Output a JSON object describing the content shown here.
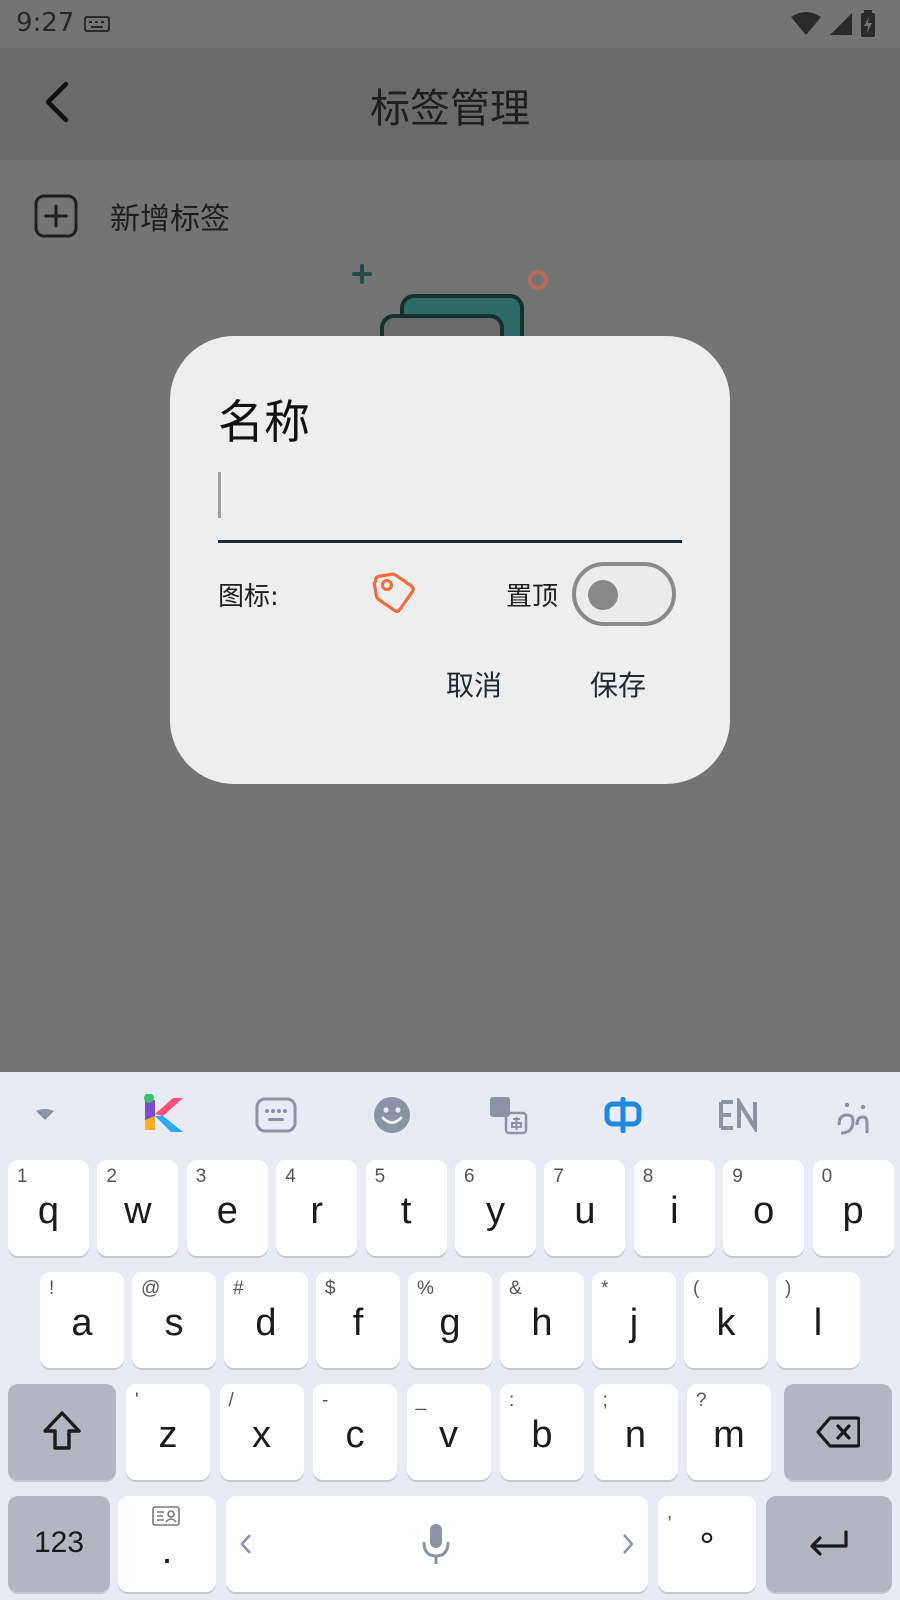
{
  "status_bar": {
    "time": "9:27"
  },
  "app_bar": {
    "title": "标签管理"
  },
  "list": {
    "add_label": "新增标签"
  },
  "dialog": {
    "title": "名称",
    "name_value": "",
    "icon_label": "图标:",
    "pin_label": "置顶",
    "pin_on": false,
    "cancel_label": "取消",
    "save_label": "保存"
  },
  "keyboard": {
    "rows": [
      [
        {
          "main": "q",
          "hint": "1"
        },
        {
          "main": "w",
          "hint": "2"
        },
        {
          "main": "e",
          "hint": "3"
        },
        {
          "main": "r",
          "hint": "4"
        },
        {
          "main": "t",
          "hint": "5"
        },
        {
          "main": "y",
          "hint": "6"
        },
        {
          "main": "u",
          "hint": "7"
        },
        {
          "main": "i",
          "hint": "8"
        },
        {
          "main": "o",
          "hint": "9"
        },
        {
          "main": "p",
          "hint": "0"
        }
      ],
      [
        {
          "main": "a",
          "hint": "!"
        },
        {
          "main": "s",
          "hint": "@"
        },
        {
          "main": "d",
          "hint": "#"
        },
        {
          "main": "f",
          "hint": "$"
        },
        {
          "main": "g",
          "hint": "%"
        },
        {
          "main": "h",
          "hint": "&"
        },
        {
          "main": "j",
          "hint": "*"
        },
        {
          "main": "k",
          "hint": "("
        },
        {
          "main": "l",
          "hint": ")"
        }
      ],
      [
        {
          "main": "z",
          "hint": "'"
        },
        {
          "main": "x",
          "hint": "/"
        },
        {
          "main": "c",
          "hint": "-"
        },
        {
          "main": "v",
          "hint": "_"
        },
        {
          "main": "b",
          "hint": ":"
        },
        {
          "main": "n",
          "hint": ";"
        },
        {
          "main": "m",
          "hint": "?"
        }
      ]
    ],
    "numbers_label": "123",
    "dot_label": ".",
    "comma_hint": ",",
    "comma_main": "°"
  },
  "colors": {
    "accent": "#1e88e5",
    "tag_icon": "#f26b3a",
    "dialog_bg": "#eeeeee"
  },
  "icons": [
    "back-arrow-icon",
    "plus-box-icon",
    "tag-icon",
    "mic-icon",
    "shift-icon",
    "backspace-icon",
    "emoji-icon",
    "keyboard-icon",
    "translate-icon"
  ]
}
